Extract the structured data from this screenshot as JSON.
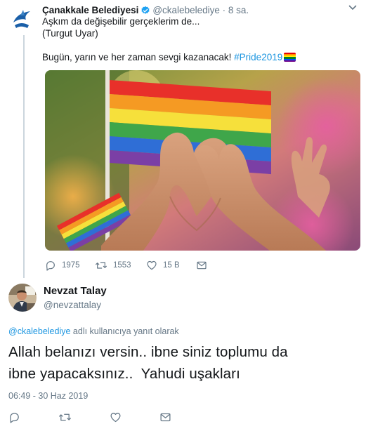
{
  "tweet": {
    "author_name": "Çanakkale Belediyesi",
    "author_handle": "@ckalebelediye",
    "separator": "·",
    "time_ago": "8 sa.",
    "text_lines": [
      "Aşkım da değişebilir gerçeklerim de...",
      "(Turgut Uyar)",
      "Bugün, yarın ve her zaman sevgi kazanacak!"
    ],
    "hashtag": "#Pride2019",
    "photo_description": "",
    "actions": {
      "reply_count": "1975",
      "retweet_count": "1553",
      "like_count": "15 B"
    },
    "colors": {
      "verified": "#1da1f2",
      "link": "#1b95e0",
      "muted": "#657786"
    }
  },
  "reply": {
    "author_name": "Nevzat Talay",
    "author_handle": "@nevzattalay",
    "reply_to_mention": "@ckalebelediye",
    "reply_to_suffix": " adlı kullanıcıya yanıt olarak",
    "text_lines": [
      "Allah belanızı versin.. ibne siniz toplumu da",
      "ibne yapacaksınız..  Yahudi uşakları"
    ],
    "timestamp": "06:49 - 30 Haz 2019"
  },
  "icons": {
    "reply": "reply-icon",
    "retweet": "retweet-icon",
    "like": "heart-icon",
    "message": "envelope-icon",
    "caret": "chevron-down-icon",
    "verified": "verified-badge-icon"
  }
}
